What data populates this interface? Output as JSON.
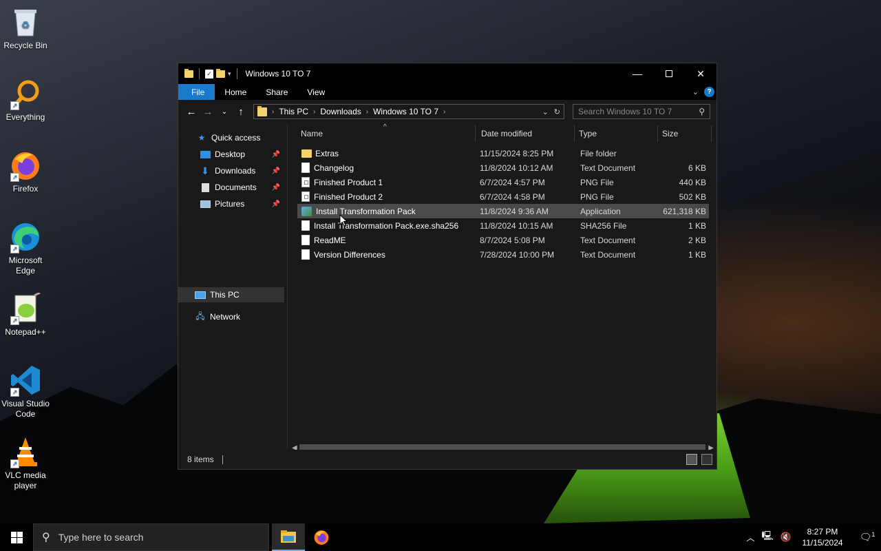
{
  "desktop": {
    "icons": [
      {
        "label": "Recycle Bin",
        "icon": "recycle-bin-icon"
      },
      {
        "label": "Everything",
        "icon": "everything-search-icon"
      },
      {
        "label": "Firefox",
        "icon": "firefox-icon"
      },
      {
        "label": "Microsoft Edge",
        "icon": "edge-icon"
      },
      {
        "label": "Notepad++",
        "icon": "notepad-plus-plus-icon"
      },
      {
        "label": "Visual Studio Code",
        "icon": "vscode-icon"
      },
      {
        "label": "VLC media player",
        "icon": "vlc-icon"
      }
    ]
  },
  "window": {
    "title": "Windows 10 TO 7",
    "ribbon_tabs": [
      "File",
      "Home",
      "Share",
      "View"
    ],
    "address": {
      "crumbs": [
        "This PC",
        "Downloads",
        "Windows 10 TO 7"
      ]
    },
    "search_placeholder": "Search Windows 10 TO 7",
    "nav": {
      "quick_access": "Quick access",
      "items": [
        {
          "label": "Desktop",
          "pinned": true
        },
        {
          "label": "Downloads",
          "pinned": true
        },
        {
          "label": "Documents",
          "pinned": true
        },
        {
          "label": "Pictures",
          "pinned": true
        }
      ],
      "this_pc": "This PC",
      "network": "Network"
    },
    "columns": [
      "Name",
      "Date modified",
      "Type",
      "Size"
    ],
    "files": [
      {
        "name": "Extras",
        "date": "11/15/2024 8:25 PM",
        "type": "File folder",
        "size": "",
        "kind": "folder"
      },
      {
        "name": "Changelog",
        "date": "11/8/2024 10:12 AM",
        "type": "Text Document",
        "size": "6 KB",
        "kind": "doc"
      },
      {
        "name": "Finished Product 1",
        "date": "6/7/2024 4:57 PM",
        "type": "PNG File",
        "size": "440 KB",
        "kind": "png"
      },
      {
        "name": "Finished Product 2",
        "date": "6/7/2024 4:58 PM",
        "type": "PNG File",
        "size": "502 KB",
        "kind": "png"
      },
      {
        "name": "Install Transformation Pack",
        "date": "11/8/2024 9:36 AM",
        "type": "Application",
        "size": "621,318 KB",
        "kind": "app"
      },
      {
        "name": "Install Transformation Pack.exe.sha256",
        "date": "11/8/2024 10:15 AM",
        "type": "SHA256 File",
        "size": "1 KB",
        "kind": "doc"
      },
      {
        "name": "ReadME",
        "date": "8/7/2024 5:08 PM",
        "type": "Text Document",
        "size": "2 KB",
        "kind": "doc"
      },
      {
        "name": "Version Differences",
        "date": "7/28/2024 10:00 PM",
        "type": "Text Document",
        "size": "1 KB",
        "kind": "doc"
      }
    ],
    "status": "8 items"
  },
  "taskbar": {
    "search_placeholder": "Type here to search",
    "time": "8:27 PM",
    "date": "11/15/2024",
    "notification_count": "1"
  }
}
